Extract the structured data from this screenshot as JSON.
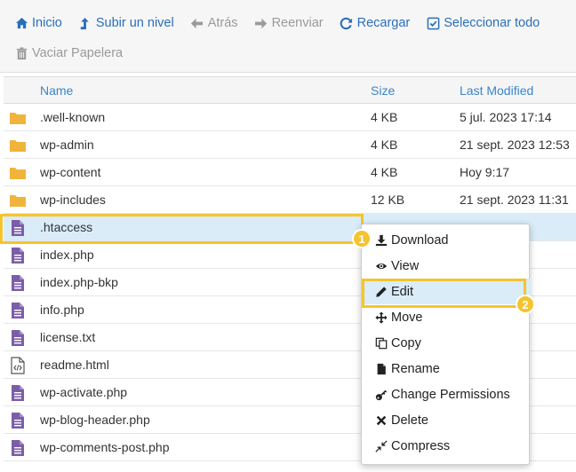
{
  "toolbar": {
    "row1": [
      {
        "id": "home",
        "label": "Inicio",
        "icon": "home-icon",
        "disabled": false
      },
      {
        "id": "up",
        "label": "Subir un nivel",
        "icon": "level-up-icon",
        "disabled": false
      },
      {
        "id": "back",
        "label": "Atrás",
        "icon": "arrow-left-icon",
        "disabled": true
      },
      {
        "id": "forward",
        "label": "Reenviar",
        "icon": "arrow-right-icon",
        "disabled": true
      },
      {
        "id": "reload",
        "label": "Recargar",
        "icon": "reload-icon",
        "disabled": false
      },
      {
        "id": "select-all",
        "label": "Seleccionar todo",
        "icon": "checkbox-icon",
        "disabled": false
      }
    ],
    "row2": [
      {
        "id": "empty-trash",
        "label": "Vaciar Papelera",
        "icon": "trash-icon",
        "disabled": true
      }
    ]
  },
  "table": {
    "headers": {
      "name": "Name",
      "size": "Size",
      "modified": "Last Modified"
    },
    "rows": [
      {
        "type": "folder",
        "name": ".well-known",
        "size": "4 KB",
        "modified": "5 jul. 2023 17:14"
      },
      {
        "type": "folder",
        "name": "wp-admin",
        "size": "4 KB",
        "modified": "21 sept. 2023 12:53"
      },
      {
        "type": "folder",
        "name": "wp-content",
        "size": "4 KB",
        "modified": "Hoy 9:17"
      },
      {
        "type": "folder",
        "name": "wp-includes",
        "size": "12 KB",
        "modified": "21 sept. 2023 11:31"
      },
      {
        "type": "file",
        "name": ".htaccess",
        "size": "",
        "modified": "",
        "selected": true
      },
      {
        "type": "file",
        "name": "index.php",
        "size": "",
        "modified": "3 17:11"
      },
      {
        "type": "file",
        "name": "index.php-bkp",
        "size": "",
        "modified": "2:03"
      },
      {
        "type": "file",
        "name": "info.php",
        "size": "",
        "modified": "16:11"
      },
      {
        "type": "file",
        "name": "license.txt",
        "size": "",
        "modified": "5:36"
      },
      {
        "type": "code",
        "name": "readme.html",
        "size": "",
        "modified": "3:11"
      },
      {
        "type": "file",
        "name": "wp-activate.php",
        "size": "",
        "modified": "3 3:05"
      },
      {
        "type": "file",
        "name": "wp-blog-header.php",
        "size": "",
        "modified": "2:03"
      },
      {
        "type": "file",
        "name": "wp-comments-post.php",
        "size": "",
        "modified": "19:41"
      }
    ]
  },
  "context_menu": [
    {
      "label": "Download",
      "icon": "download-icon"
    },
    {
      "label": "View",
      "icon": "eye-icon"
    },
    {
      "label": "Edit",
      "icon": "pencil-icon",
      "active": true
    },
    {
      "label": "Move",
      "icon": "move-icon"
    },
    {
      "label": "Copy",
      "icon": "copy-icon"
    },
    {
      "label": "Rename",
      "icon": "file-icon"
    },
    {
      "label": "Change Permissions",
      "icon": "key-icon"
    },
    {
      "label": "Delete",
      "icon": "x-icon"
    },
    {
      "label": "Compress",
      "icon": "compress-icon"
    }
  ],
  "badges": {
    "step1": "1",
    "step2": "2"
  },
  "colors": {
    "link": "#2a6ebb",
    "header": "#3a86c8",
    "folder": "#f0b43c",
    "file": "#7b5ea7",
    "highlight": "#f4c430",
    "selected": "#d9ecf8"
  }
}
